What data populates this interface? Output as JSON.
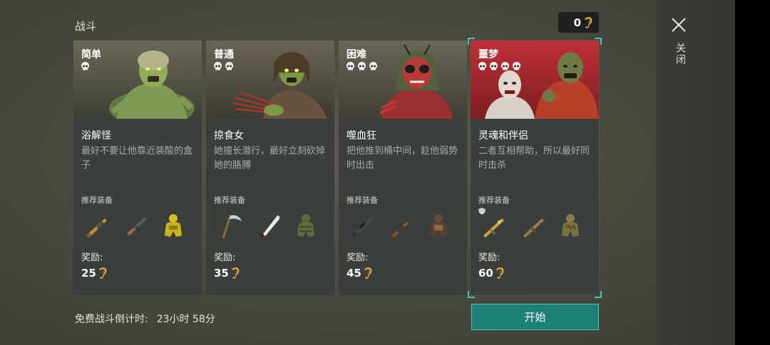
{
  "header": {
    "title": "战斗",
    "currency_value": "0",
    "currency_icon": "ear-icon"
  },
  "cards": [
    {
      "difficulty": "简单",
      "skulls": 1,
      "name": "浴解怪",
      "desc": "最好不要让他靠近装酸的盒子",
      "rec_label": "推荐装备",
      "reward_label": "奖励:",
      "reward": "25",
      "gear": [
        "rifle-icon",
        "assault-rifle-icon",
        "hazmat-armor-icon"
      ]
    },
    {
      "difficulty": "普通",
      "skulls": 2,
      "name": "掠食女",
      "desc": "她擅长潜行，最好立刻砍掉她的胳膊",
      "rec_label": "推荐装备",
      "reward_label": "奖励:",
      "reward": "35",
      "gear": [
        "scythe-icon",
        "machete-icon",
        "ghillie-armor-icon"
      ]
    },
    {
      "difficulty": "困难",
      "skulls": 3,
      "name": "噬血狂",
      "desc": "把他推到桶中间，趁他弱势时出击",
      "rec_label": "推荐装备",
      "reward_label": "奖励:",
      "reward": "45",
      "gear": [
        "sniper-rifle-icon",
        "shotgun-icon",
        "heavy-armor-icon"
      ]
    },
    {
      "difficulty": "噩梦",
      "skulls": 4,
      "name": "灵魂和伴侣",
      "desc": "二者互相帮助，所以最好同时击杀",
      "rec_label": "推荐装备",
      "reward_label": "奖励:",
      "reward": "60",
      "gear": [
        "golden-gun-icon",
        "smg-icon",
        "camo-armor-icon"
      ],
      "selected": true
    }
  ],
  "footer": {
    "timer_label": "免费战斗倒计时:",
    "timer_value": "23小时 58分",
    "start_label": "开始"
  },
  "side": {
    "close_label": "关闭",
    "close_icon": "close-icon"
  },
  "colors": {
    "accent": "#3cc7be",
    "start_bg": "#1e8077",
    "nightmare_banner": "#a8282b"
  }
}
